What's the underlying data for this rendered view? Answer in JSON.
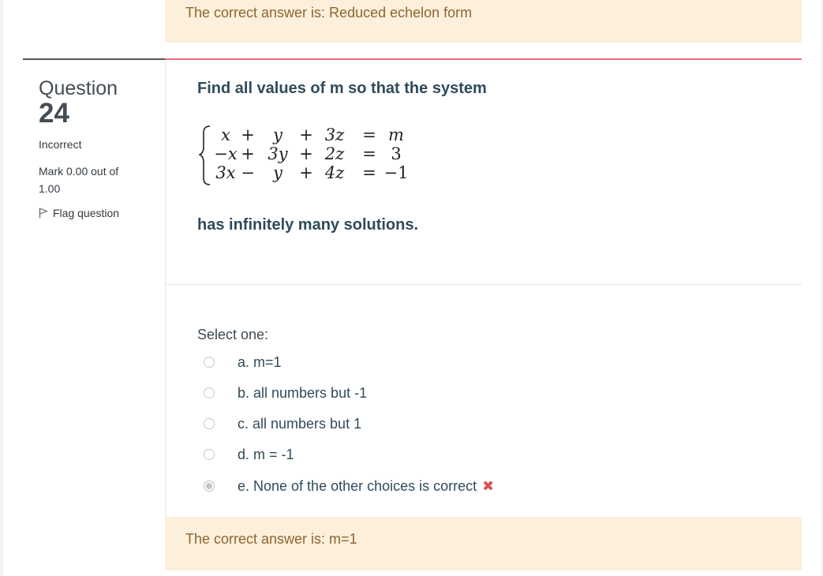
{
  "previous_feedback": {
    "text": "The correct answer is: Reduced echelon form"
  },
  "info": {
    "question_label": "Question",
    "question_number": "24",
    "state": "Incorrect",
    "grade": "Mark 0.00 out of 1.00",
    "flag_label": "Flag question",
    "flag_icon": "flag-icon"
  },
  "question": {
    "intro": "Find all values of m so that the system",
    "system": {
      "rows": [
        [
          "x",
          "+",
          "y",
          "+",
          "3z",
          "=",
          "m"
        ],
        [
          "−x",
          "+",
          "3y",
          "+",
          "2z",
          "=",
          "3"
        ],
        [
          "3x",
          "−",
          "y",
          "+",
          "4z",
          "=",
          "−1"
        ]
      ]
    },
    "outro": "has infinitely many solutions."
  },
  "answer_block": {
    "prompt": "Select one:",
    "options": [
      {
        "label": "a. m=1",
        "selected": false
      },
      {
        "label": "b. all numbers but -1",
        "selected": false
      },
      {
        "label": "c. all numbers but 1",
        "selected": false
      },
      {
        "label": "d. m = -1",
        "selected": false
      },
      {
        "label": "e. None of the other choices is correct",
        "selected": true,
        "mark": "✖",
        "mark_icon": "incorrect-icon"
      }
    ]
  },
  "feedback": {
    "text": "The correct answer is: m=1"
  },
  "colors": {
    "feedback_bg": "#fcefdc",
    "feedback_text": "#8e662e",
    "question_text": "#2f4b5a",
    "rule": "#f06b7e",
    "incorrect_mark": "#d9534f"
  }
}
